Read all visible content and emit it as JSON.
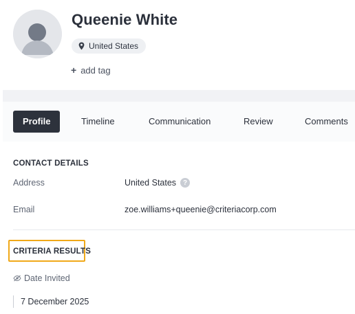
{
  "profile": {
    "name": "Queenie White",
    "location": "United States",
    "add_tag_label": "add tag",
    "add_tag_symbol": "+"
  },
  "tabs": [
    {
      "label": "Profile",
      "active": true
    },
    {
      "label": "Timeline",
      "active": false
    },
    {
      "label": "Communication",
      "active": false
    },
    {
      "label": "Review",
      "active": false
    },
    {
      "label": "Comments",
      "active": false
    }
  ],
  "contact_details": {
    "title": "CONTACT DETAILS",
    "address_label": "Address",
    "address_value": "United States",
    "email_label": "Email",
    "email_value": "zoe.williams+queenie@criteriacorp.com",
    "help_glyph": "?"
  },
  "criteria_results": {
    "title": "CRITERIA RESULTS",
    "date_invited_label": "Date Invited",
    "date_invited_value": "7 December 2025"
  },
  "colors": {
    "accent_highlight": "#f0a818",
    "active_tab_bg": "#2d323c",
    "chip_bg": "#eef0f3"
  },
  "icons": [
    "avatar-placeholder-icon",
    "location-pin-icon",
    "plus-icon",
    "help-icon",
    "eye-slash-icon"
  ]
}
